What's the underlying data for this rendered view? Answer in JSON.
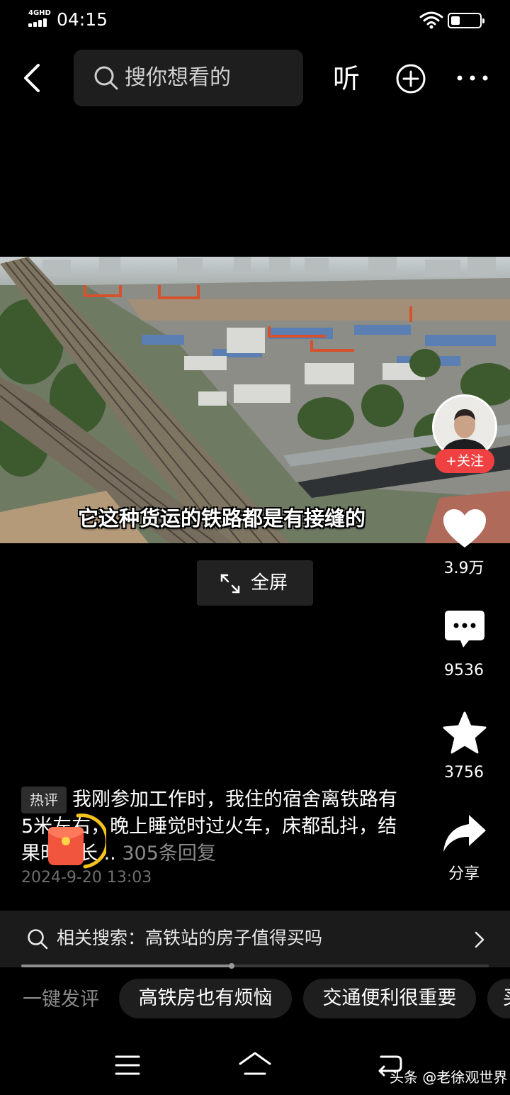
{
  "status_bar": {
    "network": "4GHD",
    "time": "04:15",
    "battery_level": 0.3
  },
  "top_bar": {
    "search_placeholder": "搜你想看的",
    "listen_label": "听"
  },
  "video": {
    "caption": "它这种货运的铁路都是有接缝的",
    "fullscreen_label": "全屏"
  },
  "author": {
    "follow_label": "+关注"
  },
  "actions": {
    "likes": "3.9万",
    "comments": "9536",
    "favorites": "3756",
    "share_label": "分享"
  },
  "hot_comment": {
    "tag": "热评",
    "text": "我刚参加工作时，我住的宿舍离铁路有5米左右，晚上睡觉时过火车，床都乱抖，结果时间长...",
    "replies": "305条回复",
    "date": "2024-9-20 13:03"
  },
  "related_search": {
    "text": "相关搜索：高铁站的房子值得买吗"
  },
  "playback_progress": 0.45,
  "quick_reply": {
    "label": "一键发评",
    "chips": [
      "高铁房也有烦恼",
      "交通便利很重要",
      "买"
    ]
  },
  "watermark": "头条 @老徐观世界",
  "colors": {
    "follow_red": "#f04142",
    "background": "#000000",
    "redpack": "#f2553d"
  }
}
